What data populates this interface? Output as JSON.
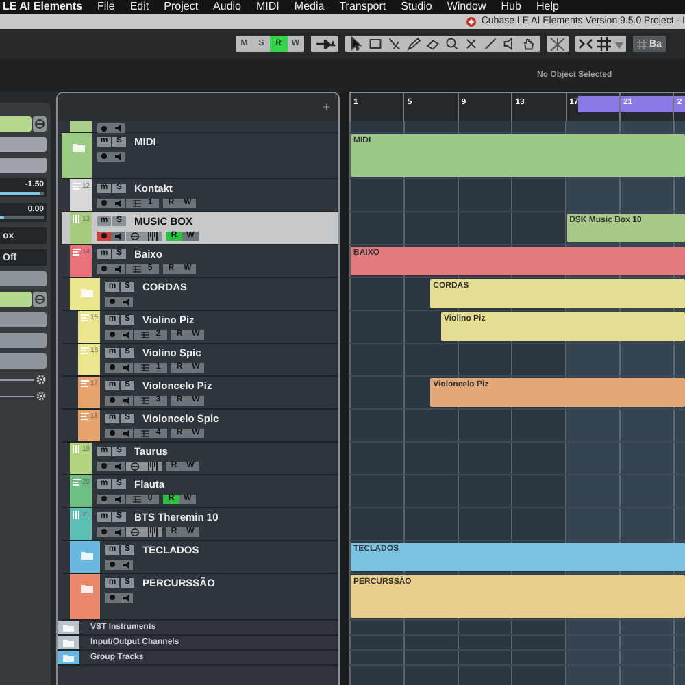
{
  "menu_bar": {
    "app": "LE AI Elements",
    "items": [
      "File",
      "Edit",
      "Project",
      "Audio",
      "MIDI",
      "Media",
      "Transport",
      "Studio",
      "Window",
      "Hub",
      "Help"
    ]
  },
  "title_bar": {
    "title": "Cubase LE AI Elements Version 9.5.0 Project - I"
  },
  "toolbar": {
    "mode_buttons": [
      {
        "label": "M",
        "selected": false
      },
      {
        "label": "S",
        "selected": false
      },
      {
        "label": "R",
        "selected": true
      },
      {
        "label": "W",
        "selected": false
      }
    ],
    "grid_label": "Ba"
  },
  "info_line": {
    "text": "No Object Selected"
  },
  "inspector": [
    {
      "kind": "header",
      "color": "#b5d98c"
    },
    {
      "kind": "field"
    },
    {
      "kind": "field"
    },
    {
      "kind": "fader",
      "text": "-1.50",
      "level": 0.92
    },
    {
      "kind": "fader",
      "text": "0.00",
      "level": 0.1
    },
    {
      "kind": "row",
      "text": "ox"
    },
    {
      "kind": "row",
      "text": "Off"
    },
    {
      "kind": "button"
    },
    {
      "kind": "header",
      "color": "#b5d98c"
    },
    {
      "kind": "button"
    },
    {
      "kind": "button"
    },
    {
      "kind": "button"
    },
    {
      "kind": "gear"
    },
    {
      "kind": "gear"
    }
  ],
  "track_list": {
    "add_label": "+",
    "tracks": [
      {
        "kind": "stub",
        "color": "#a9cf8a"
      },
      {
        "kind": "folder",
        "name": "MIDI",
        "color": "#9dcb83",
        "tall": true,
        "selected": false,
        "mute_label": "m",
        "solo_label": "S",
        "event": {
          "label": "MIDI",
          "color": "#9cc98a"
        },
        "children": [
          {
            "kind": "midi",
            "number": "12",
            "name": "Kontakt",
            "color": "#d9d9d9",
            "selected": false,
            "record": false,
            "read": false,
            "channel": "1",
            "mute_label": "m",
            "solo_label": "S",
            "read_label": "R",
            "write_label": "W"
          },
          {
            "kind": "instrument",
            "number": "13",
            "name": "MUSIC BOX",
            "color": "#a8cc7e",
            "selected": true,
            "record": true,
            "read": true,
            "mute_label": "m",
            "solo_label": "S",
            "read_label": "R",
            "write_label": "W",
            "event": {
              "label": "DSK Music Box 10",
              "color": "#a9c98a"
            }
          },
          {
            "kind": "midi",
            "number": "14",
            "name": "Baixo",
            "color": "#e8737a",
            "selected": false,
            "record": false,
            "read": false,
            "channel": "5",
            "mute_label": "m",
            "solo_label": "S",
            "read_label": "R",
            "write_label": "W",
            "event": {
              "label": "BAIXO",
              "color": "#e27b80"
            }
          },
          {
            "kind": "folder",
            "name": "CORDAS",
            "color": "#ece58f",
            "selected": false,
            "mute_label": "m",
            "solo_label": "S",
            "event": {
              "label": "CORDAS",
              "color": "#e6df93"
            },
            "children": [
              {
                "kind": "midi",
                "number": "15",
                "name": "Violino Piz",
                "color": "#ece58f",
                "selected": false,
                "record": false,
                "read": false,
                "channel": "2",
                "mute_label": "m",
                "solo_label": "S",
                "read_label": "R",
                "write_label": "W",
                "event": {
                  "label": "Violino Piz",
                  "color": "#e6df93"
                }
              },
              {
                "kind": "midi",
                "number": "16",
                "name": "Violino Spic",
                "color": "#ece58f",
                "selected": false,
                "record": false,
                "read": false,
                "channel": "1",
                "mute_label": "m",
                "solo_label": "S",
                "read_label": "R",
                "write_label": "W"
              },
              {
                "kind": "midi",
                "number": "17",
                "name": "Violoncelo Piz",
                "color": "#e8a26e",
                "selected": false,
                "record": false,
                "read": false,
                "channel": "3",
                "mute_label": "m",
                "solo_label": "S",
                "read_label": "R",
                "write_label": "W",
                "event": {
                  "label": "Violoncelo Piz",
                  "color": "#e3a87a"
                }
              },
              {
                "kind": "midi",
                "number": "18",
                "name": "Violoncelo Spic",
                "color": "#e8a26e",
                "selected": false,
                "record": false,
                "read": false,
                "channel": "4",
                "mute_label": "m",
                "solo_label": "S",
                "read_label": "R",
                "write_label": "W"
              }
            ]
          },
          {
            "kind": "instrument",
            "number": "19",
            "name": "Taurus",
            "color": "#b3d47f",
            "selected": false,
            "record": false,
            "read": false,
            "mute_label": "m",
            "solo_label": "S",
            "read_label": "R",
            "write_label": "W"
          },
          {
            "kind": "midi",
            "number": "20",
            "name": "Flauta",
            "color": "#6dbf84",
            "selected": false,
            "record": false,
            "read": true,
            "channel": "8",
            "mute_label": "m",
            "solo_label": "S",
            "read_label": "R",
            "write_label": "W"
          },
          {
            "kind": "instrument",
            "number": "21",
            "name": "BTS Theremin 10",
            "color": "#5bbfb5",
            "selected": false,
            "record": false,
            "read": false,
            "mute_label": "m",
            "solo_label": "S",
            "read_label": "R",
            "write_label": "W"
          },
          {
            "kind": "folder",
            "name": "TECLADOS",
            "color": "#6ab8e0",
            "selected": false,
            "mute_label": "m",
            "solo_label": "S",
            "event": {
              "label": "TECLADOS",
              "color": "#7cc2e3"
            }
          },
          {
            "kind": "folder",
            "name": "PERCURSSÃO",
            "color": "#e8876a",
            "tall": true,
            "selected": false,
            "mute_label": "m",
            "solo_label": "S",
            "event": {
              "label": "PERCURSSÃO",
              "color": "#e9cf8a"
            }
          }
        ]
      }
    ],
    "bottom_folders": [
      {
        "name": "VST Instruments",
        "color": "#b8c3cc"
      },
      {
        "name": "Input/Output Channels",
        "color": "#b8c3cc"
      },
      {
        "name": "Group Tracks",
        "color": "#6ab8e0"
      }
    ]
  },
  "ruler": {
    "bars": [
      "1",
      "5",
      "9",
      "13",
      "17",
      "21",
      "2"
    ]
  }
}
